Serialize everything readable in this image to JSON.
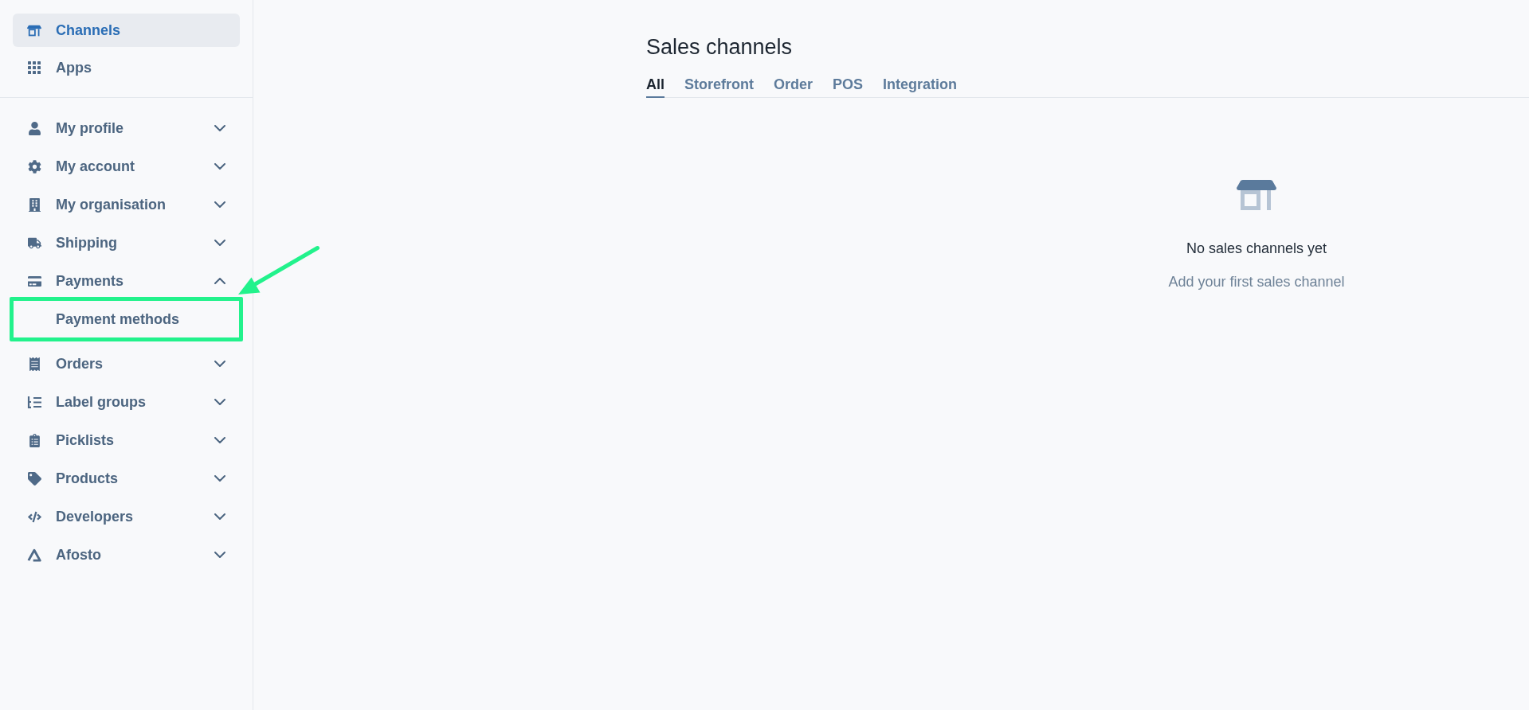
{
  "sidebar": {
    "top_items": [
      {
        "label": "Channels",
        "selected": true
      },
      {
        "label": "Apps",
        "selected": false
      }
    ],
    "sections": [
      {
        "label": "My profile",
        "expanded": false
      },
      {
        "label": "My account",
        "expanded": false
      },
      {
        "label": "My organisation",
        "expanded": false
      },
      {
        "label": "Shipping",
        "expanded": false
      },
      {
        "label": "Payments",
        "expanded": true,
        "children": [
          {
            "label": "Payment methods",
            "selected": false,
            "annotated": true
          }
        ]
      },
      {
        "label": "Orders",
        "expanded": false
      },
      {
        "label": "Label groups",
        "expanded": false
      },
      {
        "label": "Picklists",
        "expanded": false
      },
      {
        "label": "Products",
        "expanded": false
      },
      {
        "label": "Developers",
        "expanded": false
      },
      {
        "label": "Afosto",
        "expanded": false
      }
    ]
  },
  "main": {
    "title": "Sales channels",
    "tabs": [
      {
        "label": "All",
        "selected": true
      },
      {
        "label": "Storefront",
        "selected": false
      },
      {
        "label": "Order",
        "selected": false
      },
      {
        "label": "POS",
        "selected": false
      },
      {
        "label": "Integration",
        "selected": false
      }
    ],
    "empty_state": {
      "title": "No sales channels yet",
      "message": "Add your first sales channel"
    }
  }
}
